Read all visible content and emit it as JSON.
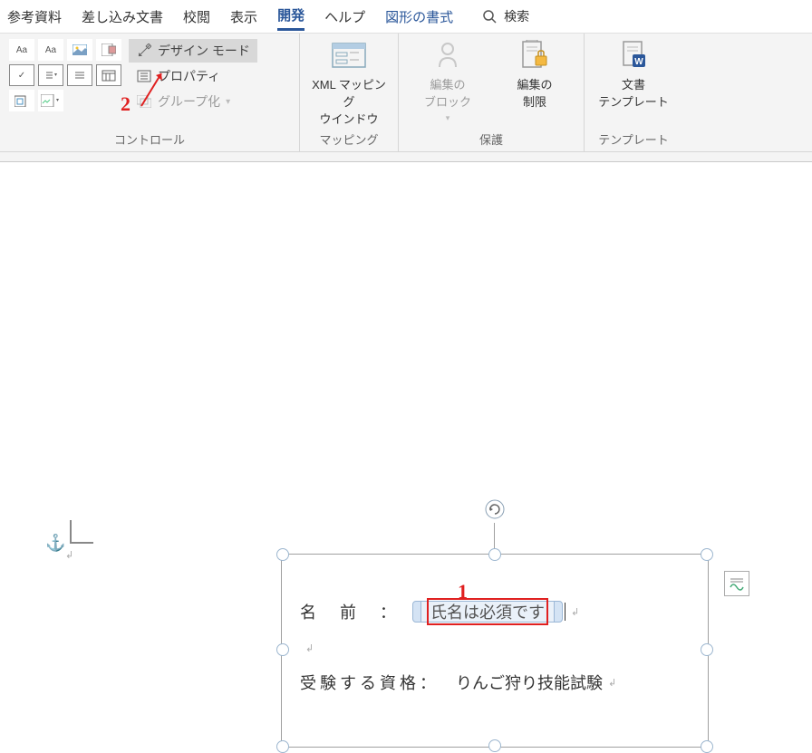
{
  "tabs": {
    "references": "参考資料",
    "mailings": "差し込み文書",
    "review": "校閲",
    "view": "表示",
    "developer": "開発",
    "help": "ヘルプ",
    "shapeformat": "図形の書式"
  },
  "search_label": "検索",
  "controls": {
    "design_mode": "デザイン モード",
    "properties": "プロパティ",
    "group": "グループ化",
    "group_label": "コントロール"
  },
  "mapping": {
    "btn": "XML マッピング\nウインドウ",
    "group_label": "マッピング"
  },
  "protect": {
    "block": "編集の\nブロック",
    "restrict": "編集の\n制限",
    "group_label": "保護"
  },
  "template": {
    "btn": "文書\nテンプレート",
    "group_label": "テンプレート"
  },
  "form": {
    "name_label": "名　前　：",
    "name_placeholder": "氏名は必須です",
    "qual_label": "受験する資格：",
    "qual_value": "りんご狩り技能試験"
  },
  "callouts": {
    "c1": "1",
    "c2": "2"
  }
}
